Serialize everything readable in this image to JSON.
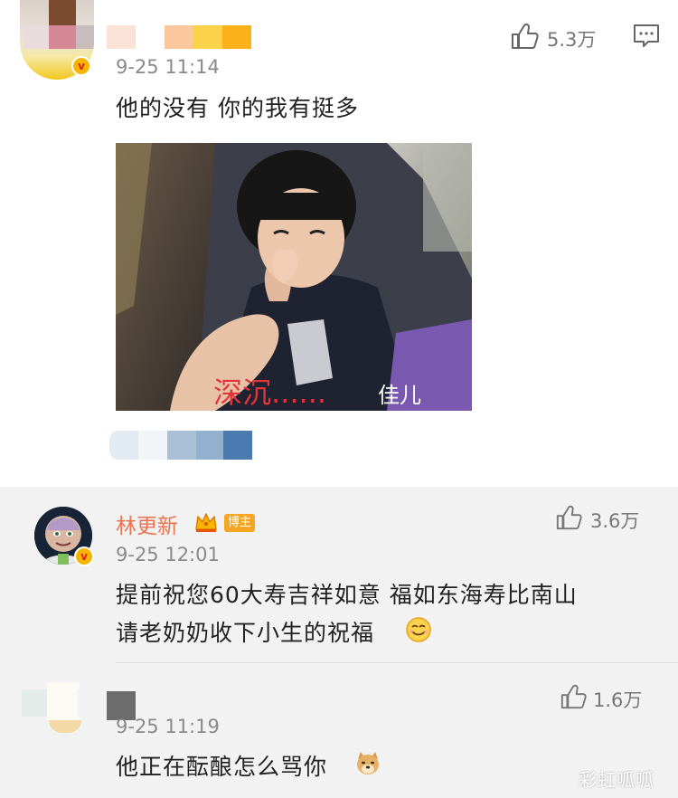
{
  "top_comment": {
    "time": "9-25 11:14",
    "like_count": "5.3万",
    "text": "他的没有 你的我有挺多",
    "sticker_caption": "深沉......",
    "sticker_corner_text": "佳儿",
    "like_icon": "thumbs-up-icon",
    "comment_icon": "comment-icon"
  },
  "replies": [
    {
      "username": "林更新",
      "badge": "博主",
      "time": "9-25 12:01",
      "like_count": "3.6万",
      "text_line1": "提前祝您60大寿吉祥如意 福如东海寿比南山",
      "text_line2": "请老奶奶收下小生的祝福",
      "emoji": "smile-emoji"
    },
    {
      "time": "9-25 11:19",
      "like_count": "1.6万",
      "text": "他正在酝酿怎么骂你",
      "emoji": "doge-emoji"
    }
  ],
  "watermark": "彩虹呱呱",
  "colors": {
    "username": "#eb7350",
    "reply_bg": "#f2f2f2",
    "badge": "#f5a623",
    "verified": "#f7b500"
  }
}
